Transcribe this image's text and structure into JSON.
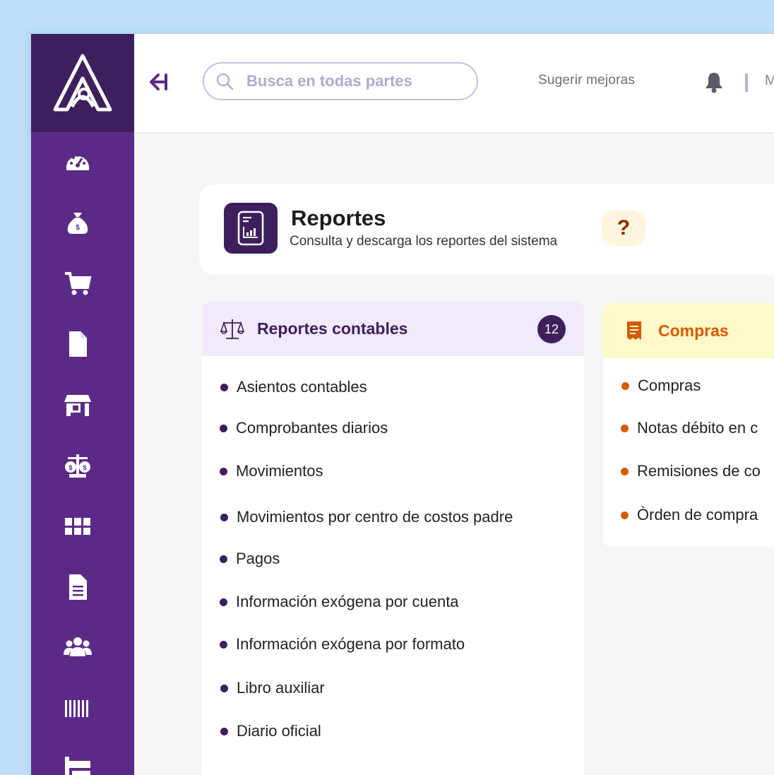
{
  "topbar": {
    "search_placeholder": "Busca en todas partes",
    "suggest_label": "Sugerir mejoras",
    "user_initial": "M"
  },
  "sidebar": {
    "items": [
      {
        "icon": "dashboard-icon"
      },
      {
        "icon": "money-bag-icon"
      },
      {
        "icon": "shopping-cart-icon"
      },
      {
        "icon": "file-icon"
      },
      {
        "icon": "store-icon"
      },
      {
        "icon": "balance-scale-icon"
      },
      {
        "icon": "box-icon"
      },
      {
        "icon": "document-lines-icon"
      },
      {
        "icon": "users-icon"
      },
      {
        "icon": "barcode-icon"
      },
      {
        "icon": "warehouse-icon"
      }
    ]
  },
  "header": {
    "title": "Reportes",
    "subtitle": "Consulta y descarga los reportes del sistema",
    "help_label": "?"
  },
  "cards": {
    "contables": {
      "title": "Reportes contables",
      "count": "12",
      "items": [
        "Asientos contables",
        "Comprobantes diarios",
        "Movimientos",
        "Movimientos por centro de costos padre",
        "Pagos",
        "Información exógena por cuenta",
        "Información exógena por formato",
        "Libro auxiliar",
        "Diario oficial"
      ]
    },
    "compras": {
      "title": "Compras",
      "items": [
        "Compras",
        "Notas débito en c",
        "Remisiones de co",
        "Òrden de compra"
      ]
    }
  },
  "colors": {
    "sidebar": "#5b2a86",
    "sidebar_dark": "#3d1f5d",
    "contables_head": "#f1eafb",
    "compras_head": "#fff8c8",
    "compras_accent": "#d65a00"
  }
}
